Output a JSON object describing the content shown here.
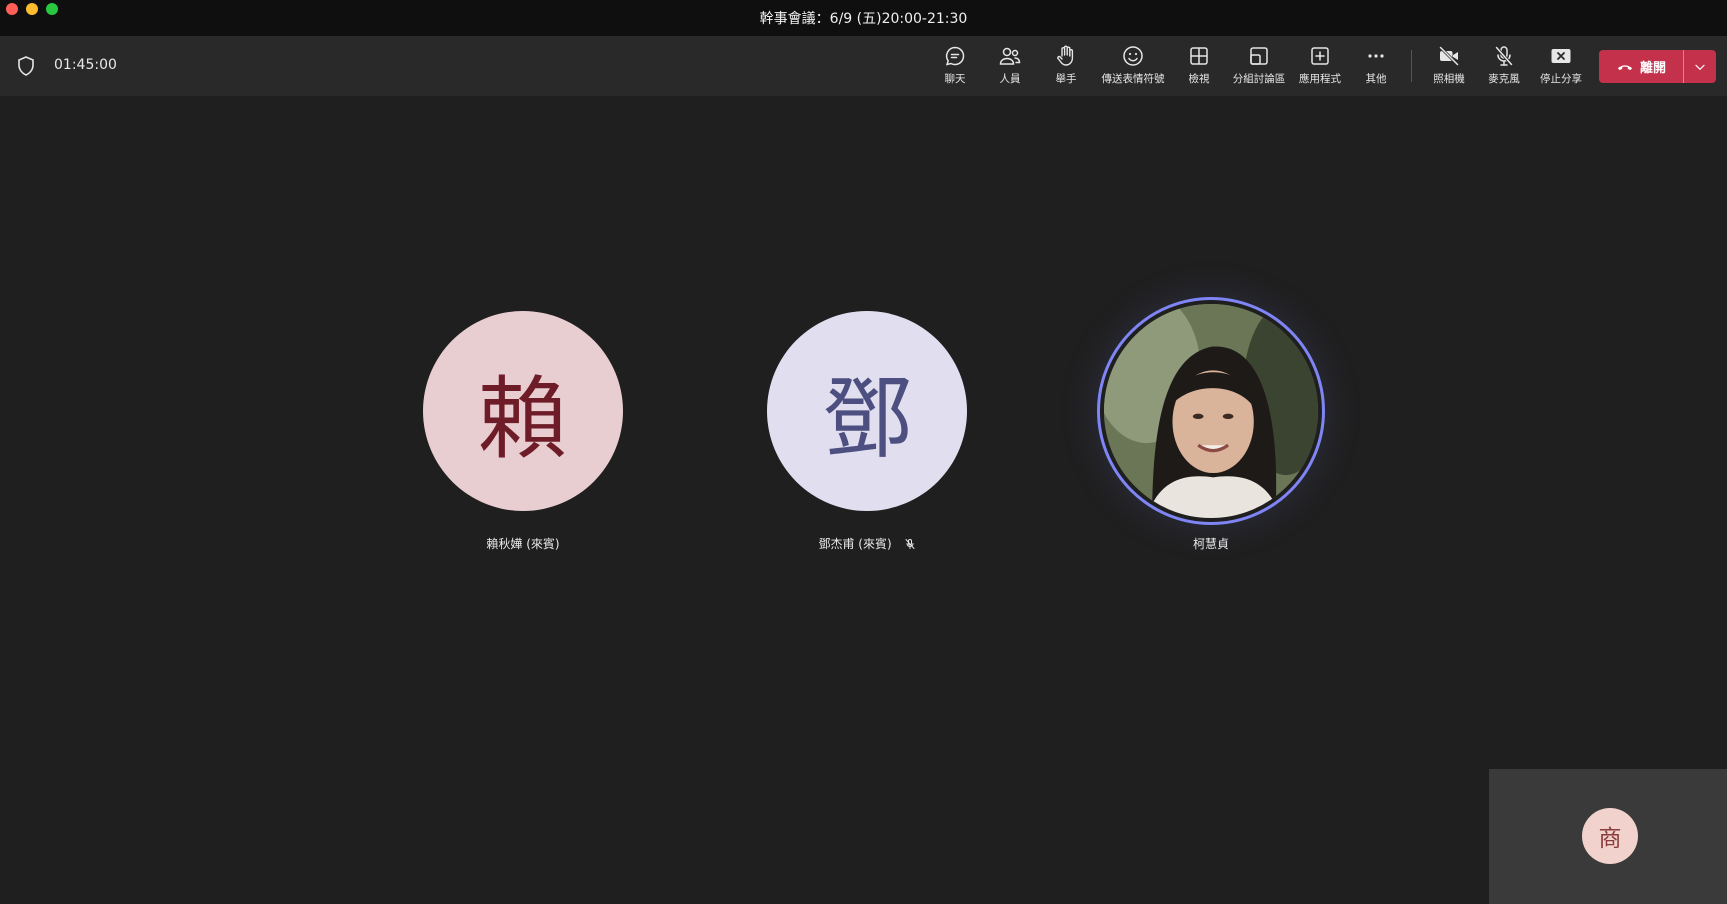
{
  "window": {
    "title": "幹事會議：6/9 (五)20:00-21:30"
  },
  "meeting": {
    "elapsed": "01:45:00"
  },
  "toolbar": {
    "chat": "聊天",
    "people": "人員",
    "raise_hand": "舉手",
    "reactions": "傳送表情符號",
    "view": "檢視",
    "breakout": "分組討論區",
    "apps": "應用程式",
    "more": "其他",
    "camera": "照相機",
    "mic": "麥克風",
    "stop_share": "停止分享",
    "leave": "離開"
  },
  "participants": [
    {
      "initial": "賴",
      "name": "賴秋嬅 (來賓)",
      "muted": false
    },
    {
      "initial": "鄧",
      "name": "鄧杰甫 (來賓)",
      "muted": true
    },
    {
      "initial": "",
      "name": "柯慧貞",
      "muted": false,
      "has_photo": true
    }
  ],
  "self": {
    "initial": "商"
  },
  "colors": {
    "background": "#1f1f1f",
    "toolbar": "#292929",
    "leave_button": "#c4314b",
    "speaking_ring": "#7f85f5"
  }
}
